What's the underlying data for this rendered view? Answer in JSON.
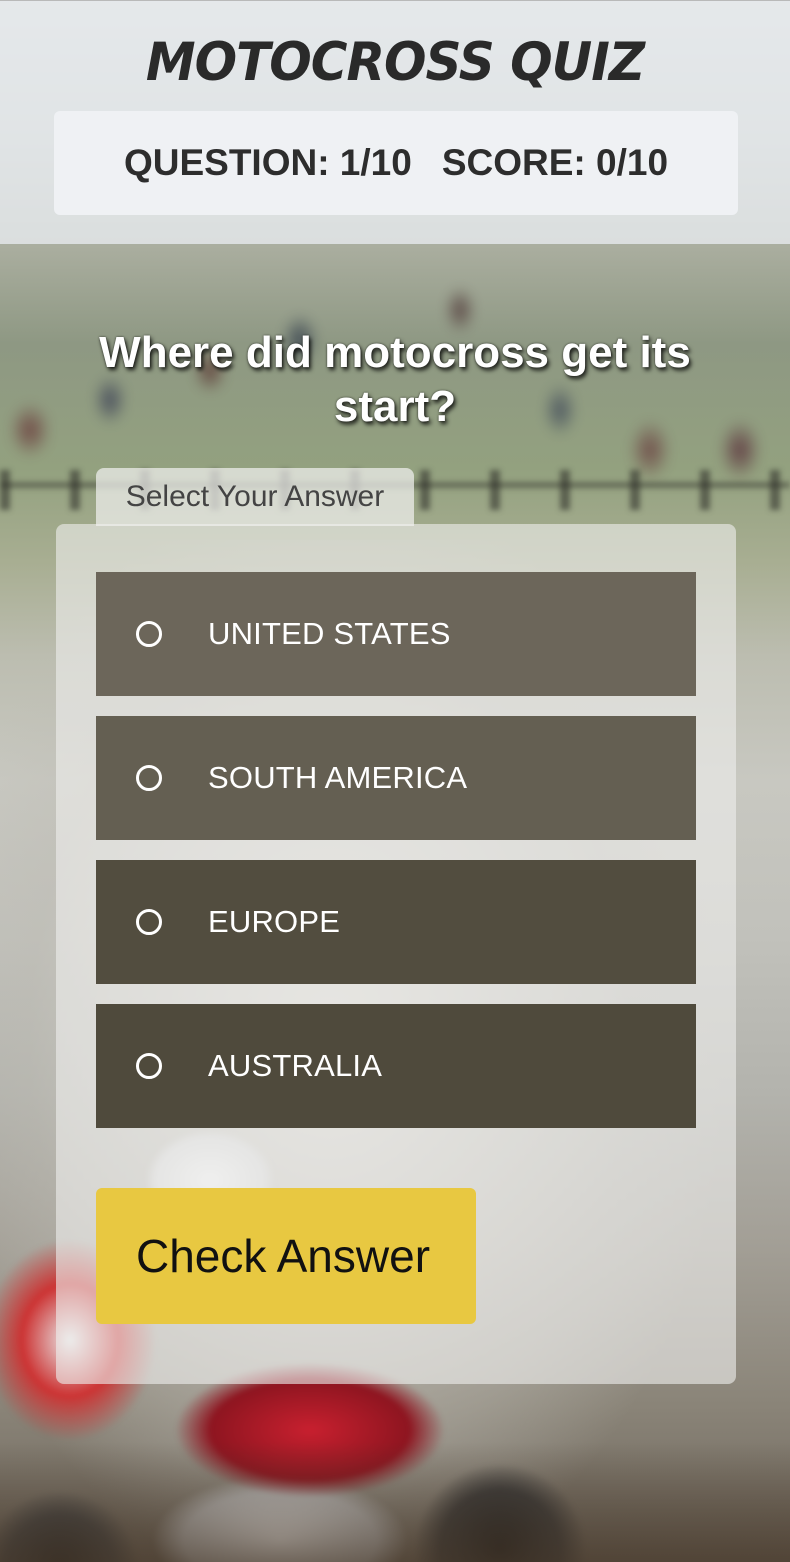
{
  "header": {
    "title": "MOTOCROSS QUIZ",
    "question_status": "QUESTION: 1/10",
    "score_status": "SCORE: 0/10"
  },
  "question": {
    "text": "Where did motocross get its start?"
  },
  "answers": {
    "legend": "Select Your Answer",
    "options": [
      {
        "label": "UNITED STATES",
        "selected": false
      },
      {
        "label": "SOUTH AMERICA",
        "selected": false
      },
      {
        "label": "EUROPE",
        "selected": false
      },
      {
        "label": "AUSTRALIA",
        "selected": false
      }
    ]
  },
  "actions": {
    "check_label": "Check Answer"
  },
  "colors": {
    "accent_button": "#e8c841",
    "option_bg": "#5a5547",
    "header_bg": "#e8ecf0"
  }
}
